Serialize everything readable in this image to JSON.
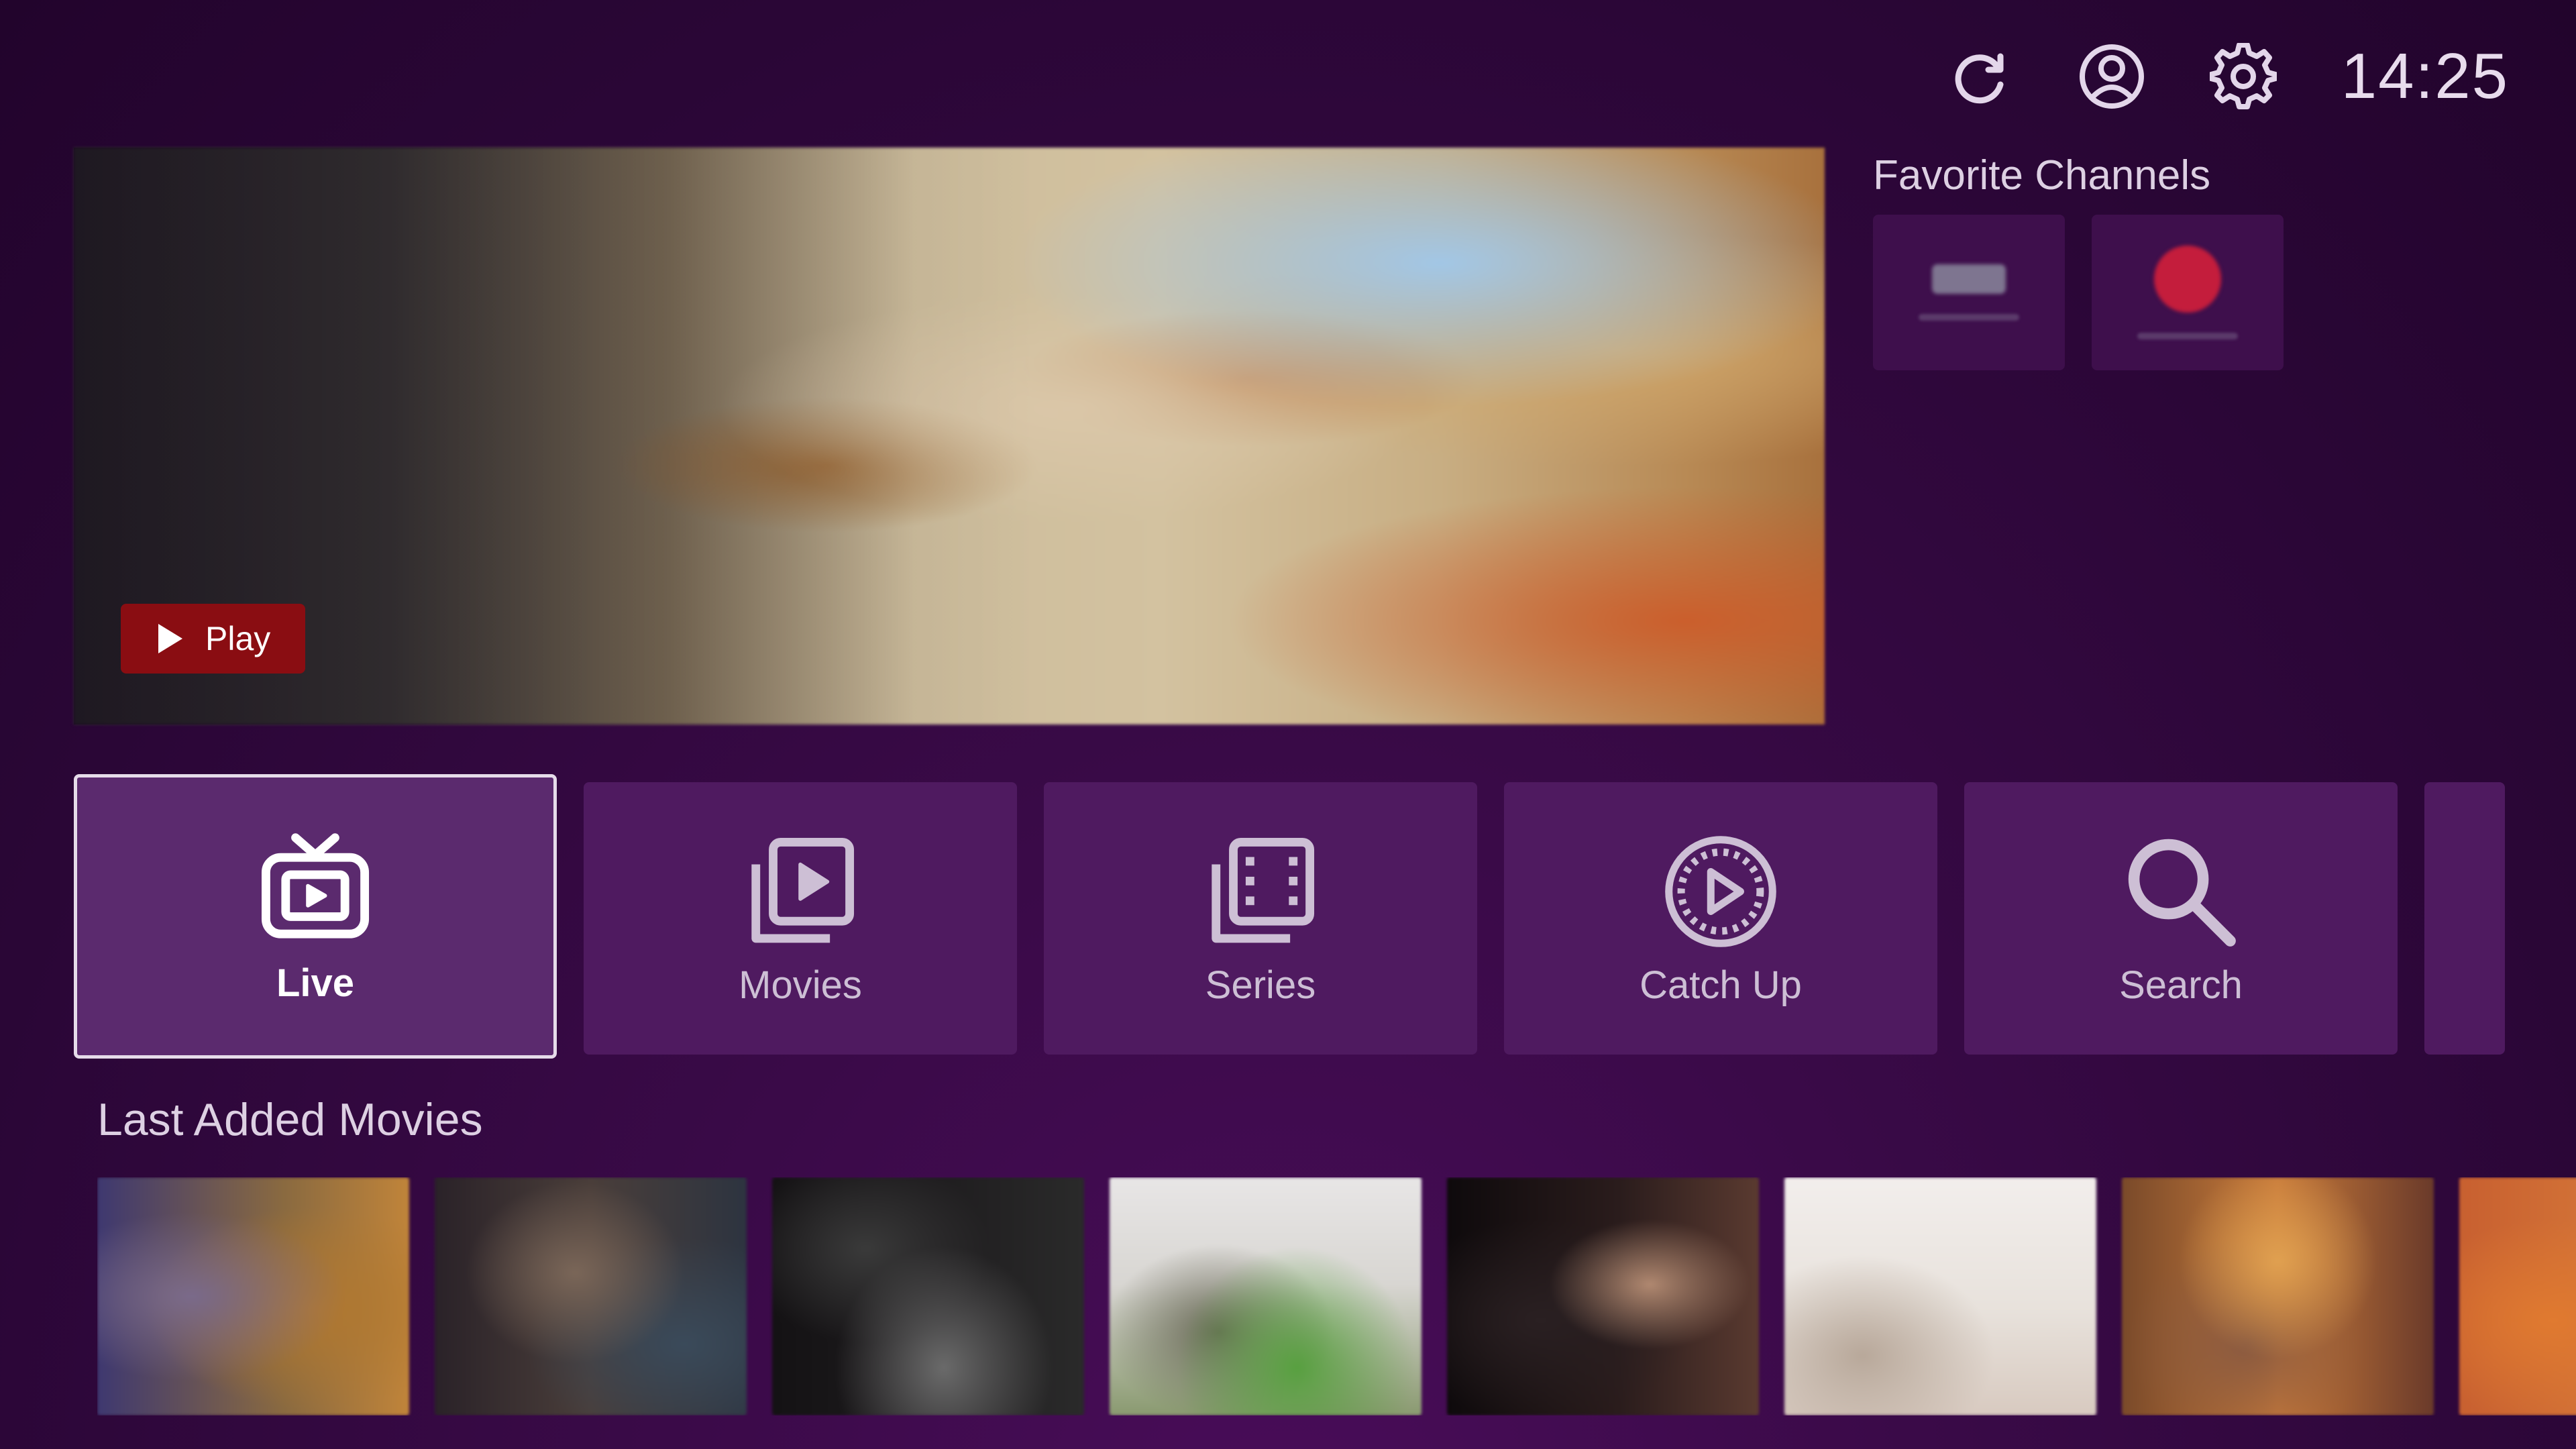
{
  "topbar": {
    "icons": [
      "refresh-icon",
      "account-icon",
      "settings-icon"
    ],
    "clock": "14:25"
  },
  "hero": {
    "play_label": "Play"
  },
  "favorites": {
    "title": "Favorite Channels",
    "channels": [
      {
        "logo_color": "#7e7590"
      },
      {
        "logo_color": "#c41d3c"
      }
    ]
  },
  "menu": {
    "items": [
      {
        "label": "Live",
        "icon": "tv-icon",
        "active": true
      },
      {
        "label": "Movies",
        "icon": "movies-icon",
        "active": false
      },
      {
        "label": "Series",
        "icon": "series-icon",
        "active": false
      },
      {
        "label": "Catch Up",
        "icon": "catch-up-icon",
        "active": false
      },
      {
        "label": "Search",
        "icon": "search-icon",
        "active": false
      }
    ]
  },
  "last_added": {
    "title": "Last Added Movies",
    "count_visible": 8
  },
  "colors": {
    "background": "#2a0636",
    "tile": "#4f1a60",
    "active_tile": "#5b2a6e",
    "play_button": "#8a0d12"
  }
}
